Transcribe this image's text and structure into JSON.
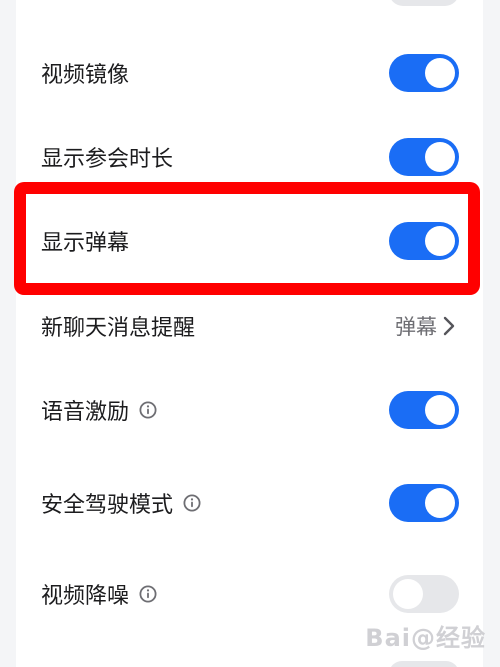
{
  "settings": {
    "rows": [
      {
        "label": "视频镜像",
        "type": "toggle",
        "on": true
      },
      {
        "label": "显示参会时长",
        "type": "toggle",
        "on": true
      },
      {
        "label": "显示弹幕",
        "type": "toggle",
        "on": true
      },
      {
        "label": "新聊天消息提醒",
        "type": "value",
        "value": "弹幕"
      },
      {
        "label": "语音激励",
        "type": "toggle",
        "on": true,
        "info": true
      },
      {
        "label": "安全驾驶模式",
        "type": "toggle",
        "on": true,
        "info": true
      },
      {
        "label": "视频降噪",
        "type": "toggle",
        "on": false,
        "info": true
      }
    ]
  },
  "watermark": "Bai@经验",
  "colors": {
    "toggle_on": "#1a6df5",
    "toggle_off": "#e6e7ea",
    "highlight": "#ff0000"
  }
}
